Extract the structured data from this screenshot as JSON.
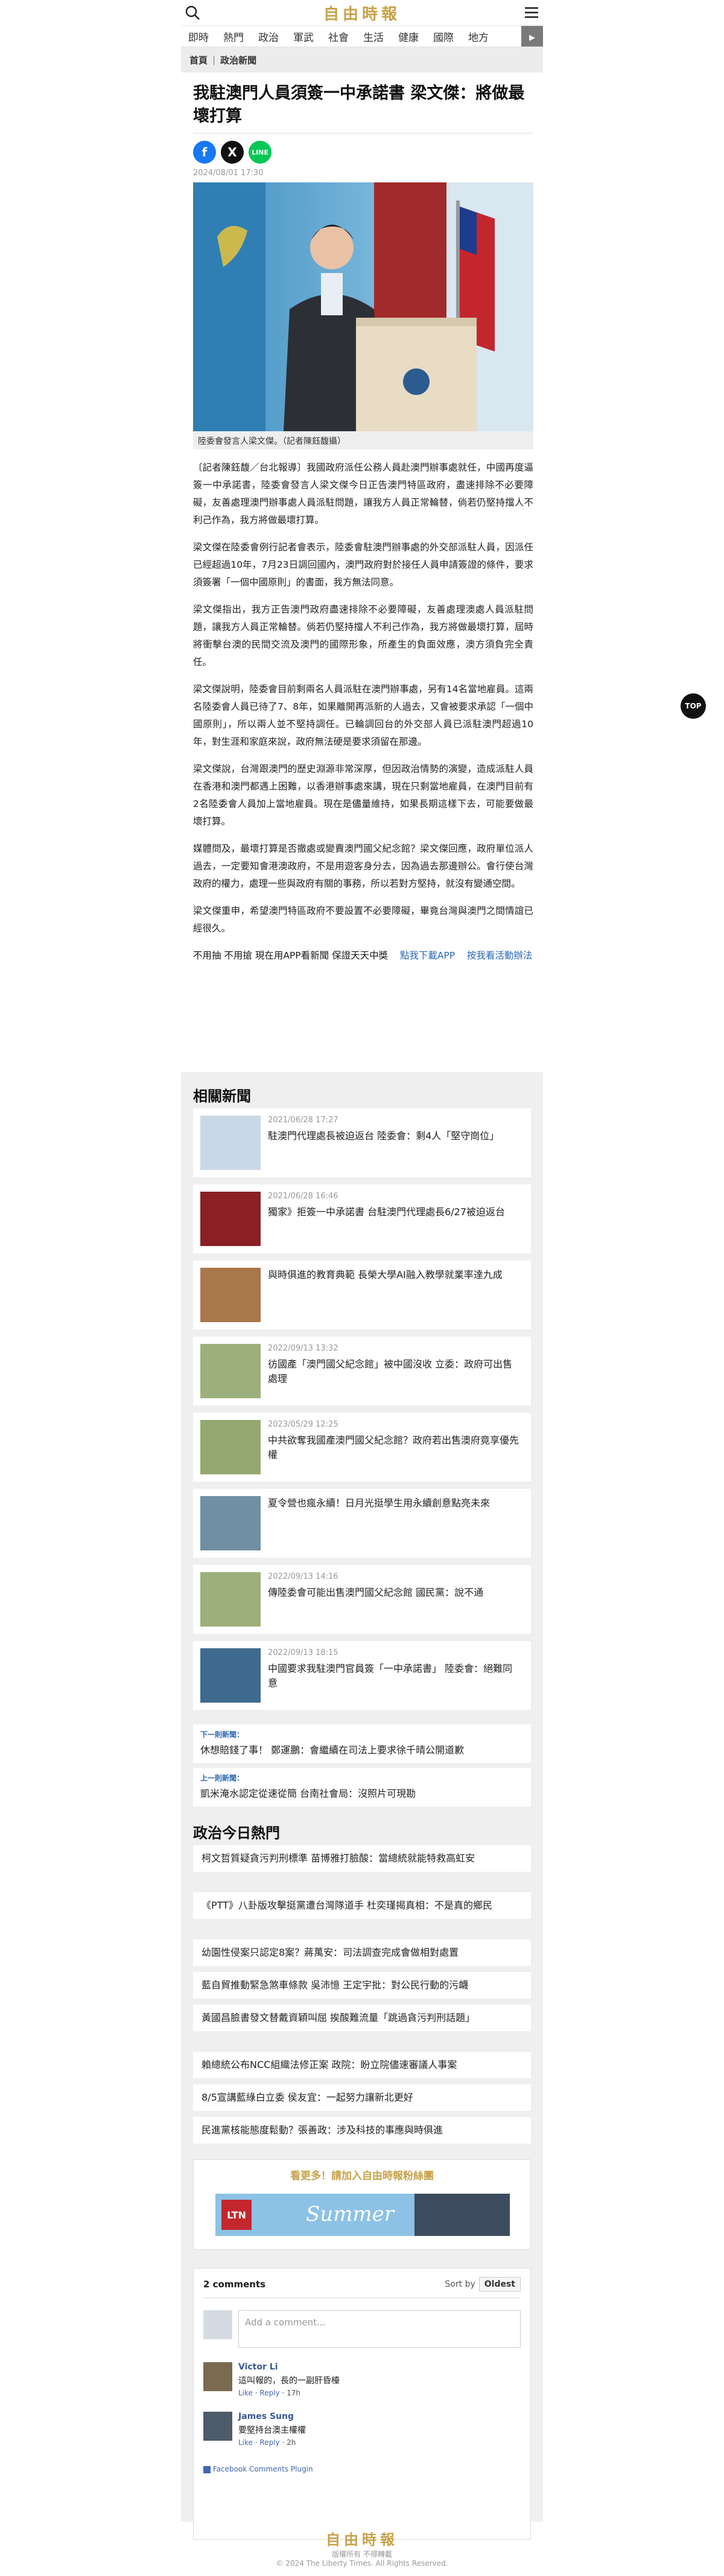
{
  "header": {
    "logo": "自由時報",
    "nav": [
      "即時",
      "熱門",
      "政治",
      "軍武",
      "社會",
      "生活",
      "健康",
      "國際",
      "地方"
    ]
  },
  "breadcrumb": [
    "首頁",
    "政治新聞"
  ],
  "article": {
    "title": "我駐澳門人員須簽一中承諾書 梁文傑：將做最壞打算",
    "date": "2024/08/01 17:30",
    "photo_caption": "陸委會發言人梁文傑。（記者陳鈺馥攝）",
    "paragraphs": [
      "〔記者陳鈺馥／台北報導〕我國政府派任公務人員赴澳門辦事處就任，中國再度逼簽一中承諾書，陸委會發言人梁文傑今日正告澳門特區政府，盡速排除不必要障礙，友善處理澳門辦事處人員派駐問題，讓我方人員正常輪替，倘若仍堅持擋人不利己作為，我方將做最壞打算。",
      "梁文傑在陸委會例行記者會表示，陸委會駐澳門辦事處的外交部派駐人員，因派任已經超過10年，7月23日調回國內，澳門政府對於接任人員申請簽證的條件，要求須簽署「一個中國原則」的書面，我方無法同意。",
      "梁文傑指出，我方正告澳門政府盡速排除不必要障礙，友善處理澳處人員派駐問題，讓我方人員正常輪替。倘若仍堅持擋人不利己作為，我方將做最壞打算，屆時將衝擊台澳的民間交流及澳門的國際形象，所產生的負面效應，澳方須負完全責任。",
      "梁文傑說明，陸委會目前剩兩名人員派駐在澳門辦事處，另有14名當地雇員。這兩名陸委會人員已待了7、8年，如果離開再派新的人過去，又會被要求承認「一個中國原則」，所以兩人並不堅持調任。已輪調回台的外交部人員已派駐澳門超過10年，對生涯和家庭來說，政府無法硬是要求須留在那邊。",
      "梁文傑說，台灣跟澳門的歷史淵源非常深厚，但因政治情勢的演變，造成派駐人員在香港和澳門都遇上困難，以香港辦事處來講，現在只剩當地雇員，在澳門目前有2名陸委會人員加上當地雇員。現在是儘量維持，如果長期這樣下去，可能要做最壞打算。",
      "媒體問及，最壞打算是否撤處或變賣澳門國父紀念館？梁文傑回應，政府單位派人過去，一定要知會港澳政府，不是用遊客身分去，因為過去那邊辦公。會行使台灣政府的權力，處理一些與政府有關的事務，所以若對方堅持，就沒有變通空間。",
      "梁文傑重申，希望澳門特區政府不要設置不必要障礙，畢竟台灣與澳門之間情誼已經很久。"
    ],
    "app_promo": "不用抽 不用搶 現在用APP看新聞 保證天天中獎",
    "app_download": "點我下載APP",
    "app_rules": "按我看活動辦法"
  },
  "related": {
    "title": "相關新聞",
    "items": [
      {
        "date": "2021/06/28 17:27",
        "title": "駐澳門代理處長被迫返台 陸委會：剩4人「堅守崗位」"
      },
      {
        "date": "2021/06/28 16:46",
        "title": "獨家》拒簽一中承諾書 台駐澳門代理處長6/27被迫返台"
      },
      {
        "date": "",
        "title": "與時俱進的教育典範 長榮大學AI融入教學就業率達九成"
      },
      {
        "date": "2022/09/13 13:32",
        "title": "彷國產「澳門國父紀念館」被中國沒收 立委：政府可出售處理"
      },
      {
        "date": "2023/05/29 12:25",
        "title": "中共欲奪我國產澳門國父紀念館？政府若出售澳府竟享優先權"
      },
      {
        "date": "",
        "title": "夏令營也瘋永續！日月光挺學生用永續創意點亮未來"
      },
      {
        "date": "2022/09/13 14:16",
        "title": "傳陸委會可能出售澳門國父紀念館 國民黨：說不通"
      },
      {
        "date": "2022/09/13 18:15",
        "title": "中國要求我駐澳門官員簽「一中承諾書」 陸委會：絕難同意"
      }
    ]
  },
  "prev_next": {
    "next_label": "下一則新聞：",
    "next_title": "休想賠錢了事！ 鄭運鵬：會繼續在司法上要求徐千晴公開道歉",
    "prev_label": "上一則新聞：",
    "prev_title": "凱米淹水認定從速從簡 台南社會局：沒照片可現勘"
  },
  "hot": {
    "title": "政治今日熱門",
    "items": [
      "柯文哲質疑貪污判刑標準 苗博雅打臉酸：當總統就能特救高虹安",
      "《PTT》八卦版攻擊挺黨遭台灣隊道手 杜奕瑾揭真相：不是真的鄉民",
      "幼園性侵案只認定8案？蔣萬安：司法調查完成會做相對處置",
      "藍自貿推動緊急煞車條款 吳沛憶 王定宇批：對公民行動的污衊",
      "黃國昌臉書發文替戴資穎叫屈 挨酸難流量「跳過貪污判刑話題」",
      "賴總統公布NCC組織法修正案 政院：盼立院儘速審議人事案",
      "8/5宣講藍綠白立委 侯友宜：一起努力讓新北更好",
      "民進黨核能態度鬆動？張善政：涉及科技的事應與時俱進"
    ]
  },
  "ad": {
    "title": "看更多！請加入自由時報粉絲團",
    "banner_text": "Summer"
  },
  "comments": {
    "count": "2 comments",
    "sort_label": "Sort by",
    "sort_value": "Oldest",
    "placeholder": "Add a comment...",
    "list": [
      {
        "name": "Victor Li",
        "text": "這叫報的，長的一副肝昏檯",
        "like": "Like",
        "reply": "Reply",
        "age": "17h"
      },
      {
        "name": "James Sung",
        "text": "要堅持台澳主權權",
        "like": "Like",
        "reply": "Reply",
        "age": "2h"
      }
    ],
    "plugin": "Facebook Comments Plugin"
  },
  "footer": {
    "logo": "自由時報",
    "sub1": "版權所有 不得轉載",
    "sub2": "© 2024 The Liberty Times. All Rights Reserved."
  },
  "top_button": "TOP"
}
